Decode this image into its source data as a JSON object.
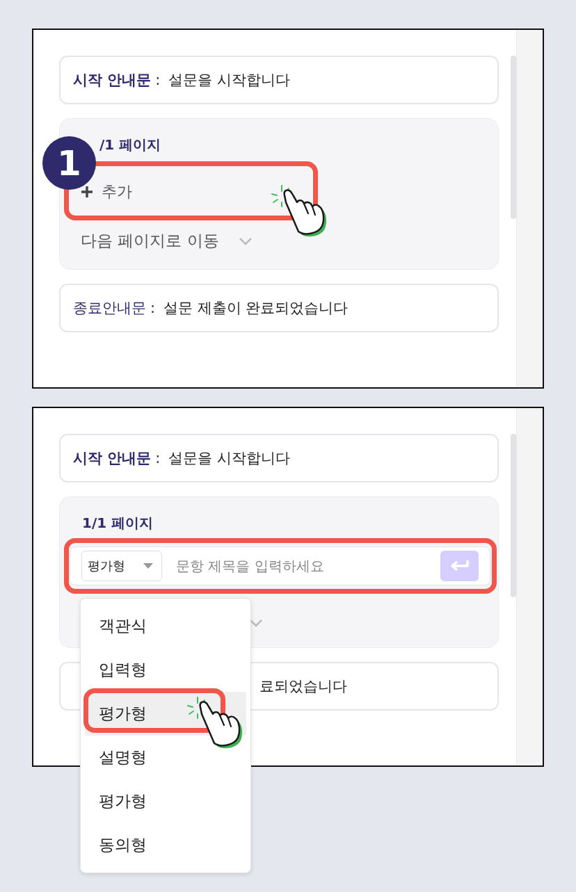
{
  "panels": [
    {
      "kind": "add_step",
      "step": "1",
      "start_card": {
        "label": "시작 안내문",
        "separator": ":",
        "text": "설문을 시작합니다"
      },
      "page": {
        "title": "/1 페이지",
        "add_button": "추가",
        "move_select": "다음 페이지로 이동"
      },
      "end_card": {
        "label": "종료안내문",
        "separator": ":",
        "text": "설문 제출이 완료되었습니다"
      }
    },
    {
      "kind": "type_menu",
      "start_card": {
        "label": "시작 안내문",
        "separator": ":",
        "text": "설문을 시작합니다"
      },
      "page": {
        "title": "1/1 페이지",
        "type_select": "평가형",
        "placeholder": "문항 제목을 입력하세요"
      },
      "end_card": {
        "text": "료되었습니다"
      },
      "menu": [
        {
          "label": "객관식",
          "selected": false
        },
        {
          "label": "입력형",
          "selected": false
        },
        {
          "label": "평가형",
          "selected": true
        },
        {
          "label": "설명형",
          "selected": false
        },
        {
          "label": "평가형",
          "selected": false
        },
        {
          "label": "동의형",
          "selected": false
        }
      ]
    }
  ]
}
